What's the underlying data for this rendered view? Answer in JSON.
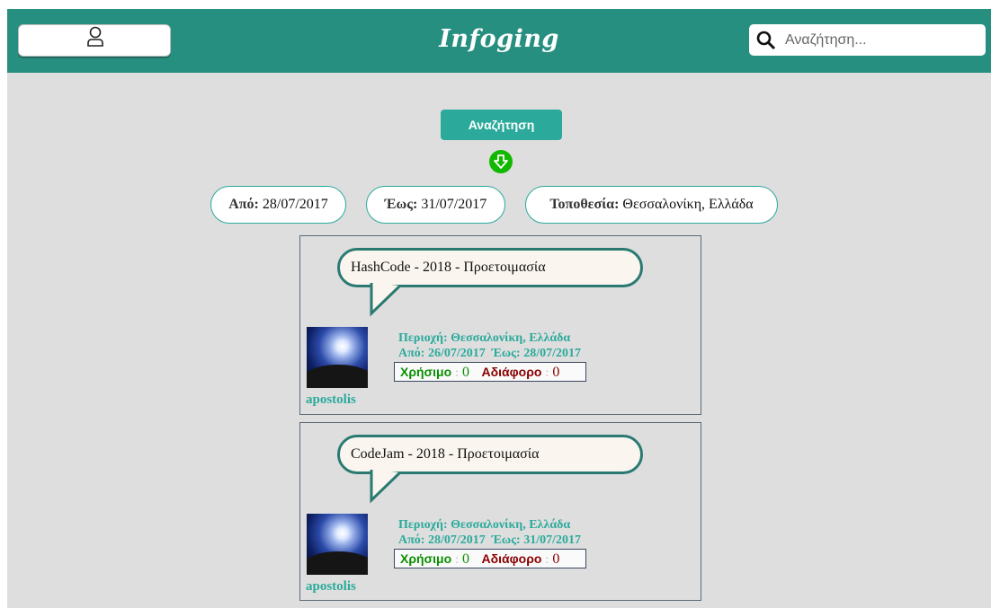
{
  "header": {
    "logo": "Infoging",
    "search_placeholder": "Αναζήτηση..."
  },
  "search_button_label": "Αναζήτηση",
  "filters": [
    {
      "label": "Από:",
      "value": "28/07/2017"
    },
    {
      "label": "Έως:",
      "value": "31/07/2017"
    },
    {
      "label": "Τοποθεσία:",
      "value": "Θεσσαλονίκη, Ελλάδα"
    }
  ],
  "posts": [
    {
      "title": "HashCode - 2018 - Προετοιμασία",
      "area": "Περιοχή: Θεσσαλονίκη, Ελλάδα",
      "dates": "Από: 26/07/2017  Έως: 28/07/2017",
      "useful_label": "Χρήσιμο",
      "useful_count": "0",
      "neutral_label": "Αδιάφορο",
      "neutral_count": "0",
      "author": "apostolis"
    },
    {
      "title": "CodeJam - 2018 - Προετοιμασία",
      "area": "Περιοχή: Θεσσαλονίκη, Ελλάδα",
      "dates": "Από: 28/07/2017  Έως: 31/07/2017",
      "useful_label": "Χρήσιμο",
      "useful_count": "0",
      "neutral_label": "Αδιάφορο",
      "neutral_count": "0",
      "author": "apostolis"
    }
  ]
}
